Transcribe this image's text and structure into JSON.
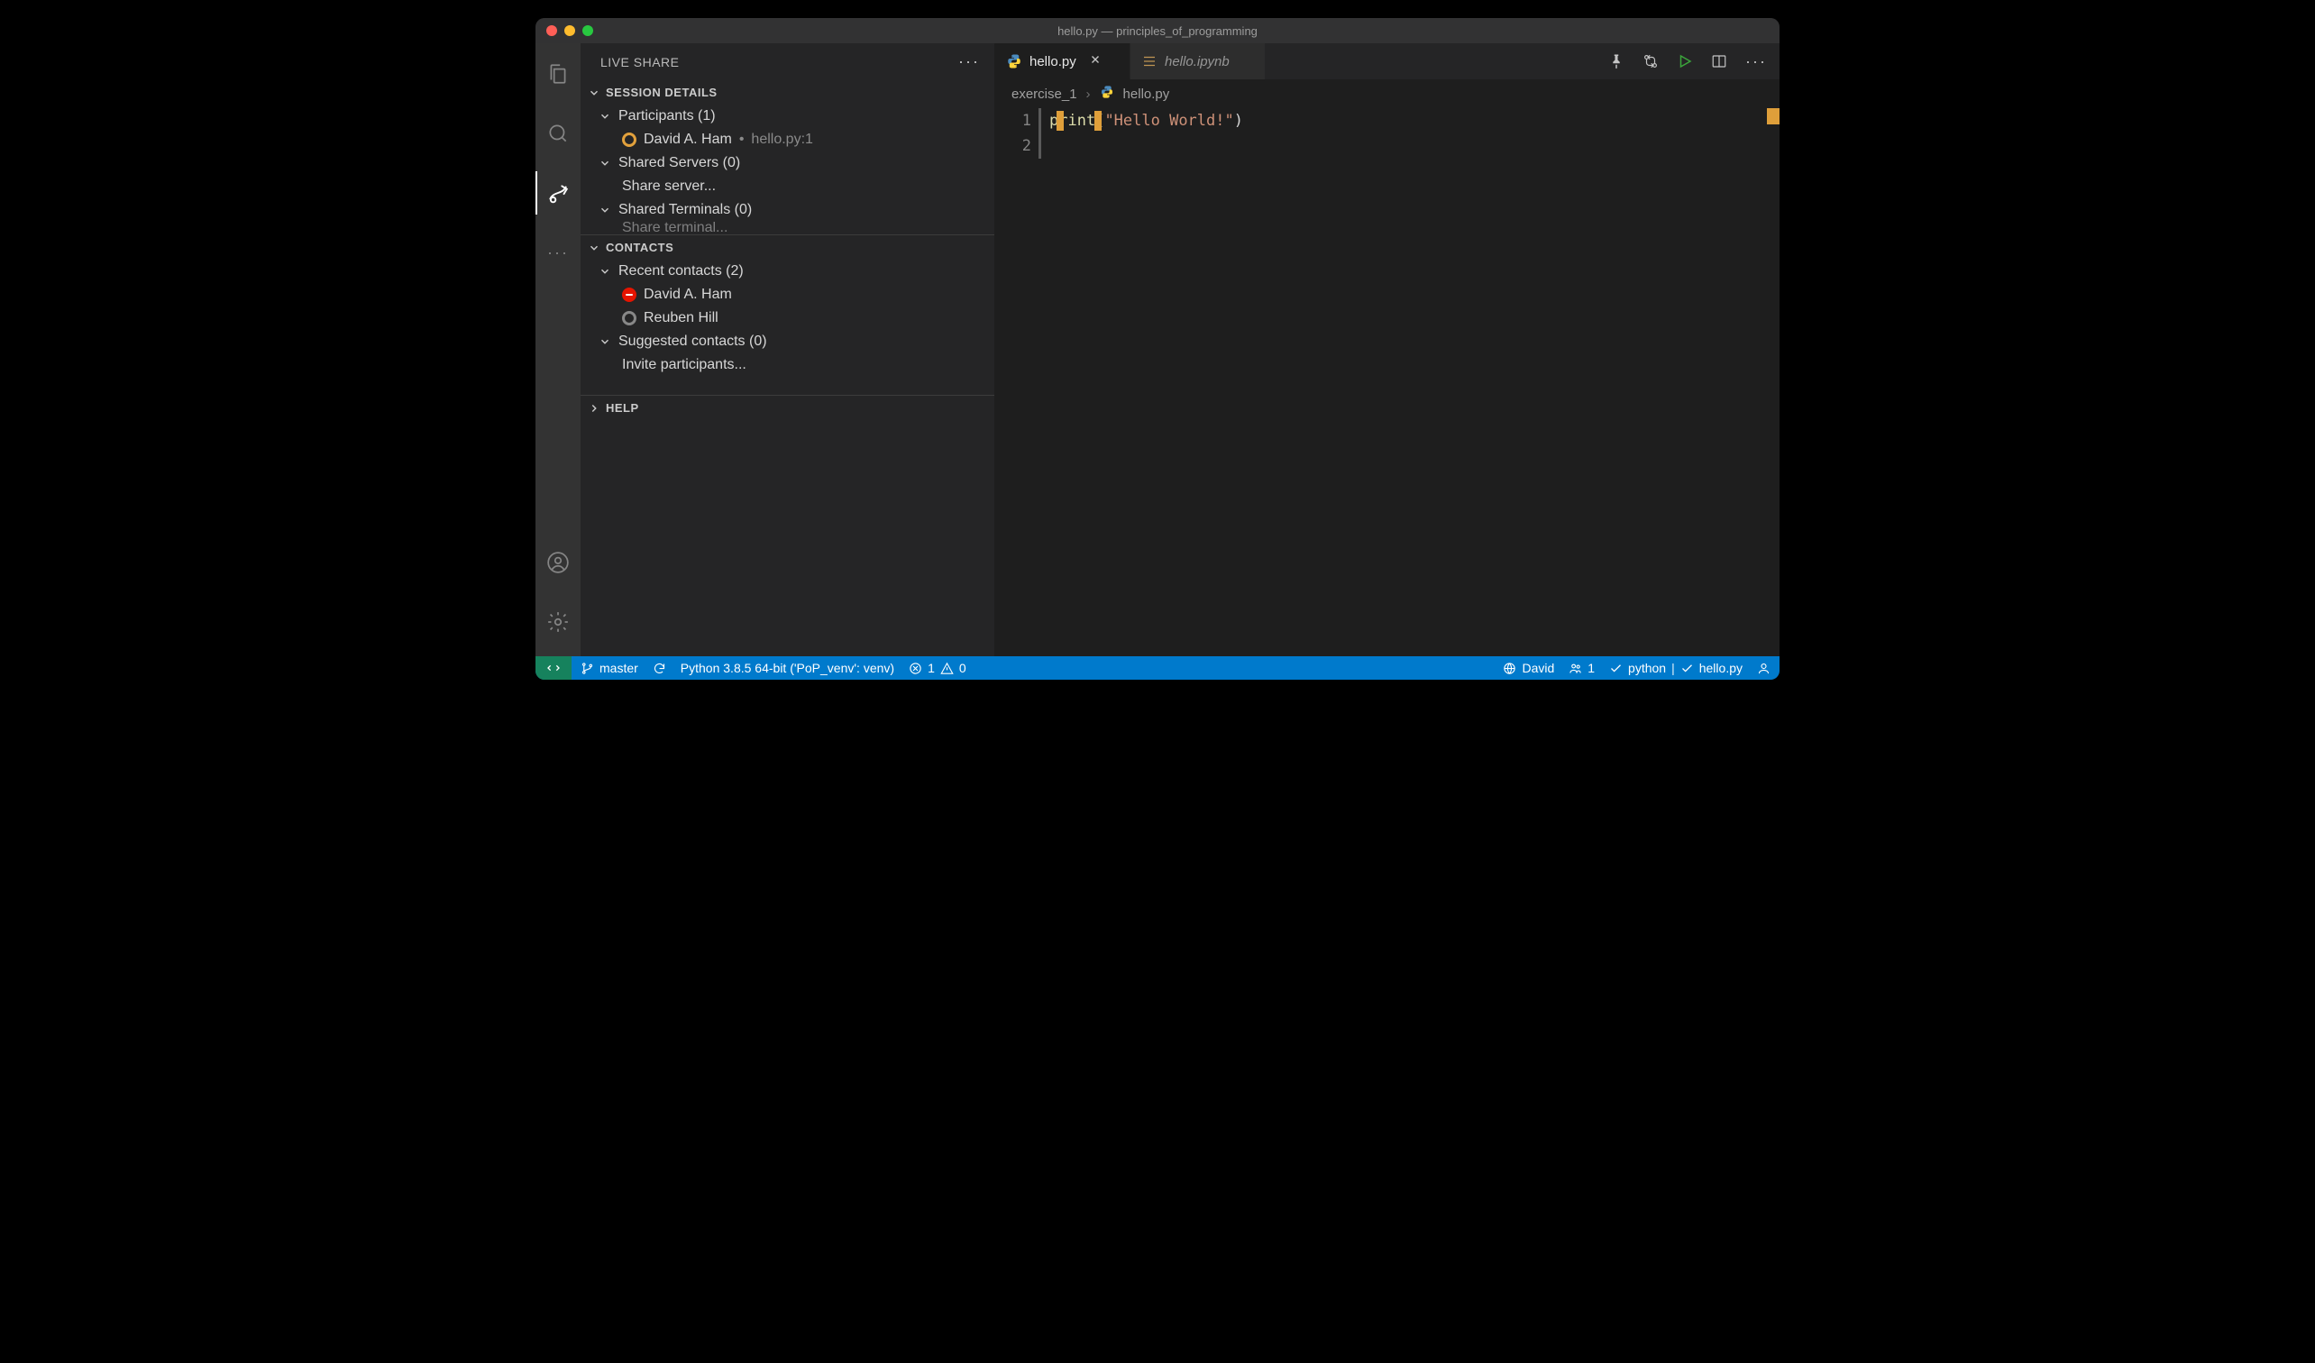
{
  "titlebar": {
    "title": "hello.py — principles_of_programming"
  },
  "sidebar": {
    "title": "LIVE SHARE",
    "sections": {
      "session": {
        "title": "SESSION DETAILS",
        "participants_label": "Participants (1)",
        "participant_name": "David A. Ham",
        "participant_loc": "hello.py:1",
        "servers_label": "Shared Servers (0)",
        "share_server": "Share server...",
        "terminals_label": "Shared Terminals (0)",
        "share_terminal": "Share terminal..."
      },
      "contacts": {
        "title": "CONTACTS",
        "recent_label": "Recent contacts (2)",
        "recent": [
          "David A. Ham",
          "Reuben Hill"
        ],
        "suggested_label": "Suggested contacts (0)",
        "invite": "Invite participants..."
      },
      "help": {
        "title": "HELP"
      }
    }
  },
  "tabs": {
    "active": {
      "label": "hello.py"
    },
    "inactive": {
      "label": "hello.ipynb"
    }
  },
  "breadcrumb": {
    "folder": "exercise_1",
    "file": "hello.py"
  },
  "code": {
    "line1_fn": "print",
    "line1_open": "(",
    "line1_str": "\"Hello World!\"",
    "line1_close": ")",
    "gutter": [
      "1",
      "2"
    ]
  },
  "status": {
    "branch": "master",
    "interpreter": "Python 3.8.5 64-bit ('PoP_venv': venv)",
    "errors": "1",
    "warnings": "0",
    "liveshare_user": "David",
    "liveshare_count": "1",
    "lint_lang": "python",
    "lint_file": "hello.py"
  }
}
